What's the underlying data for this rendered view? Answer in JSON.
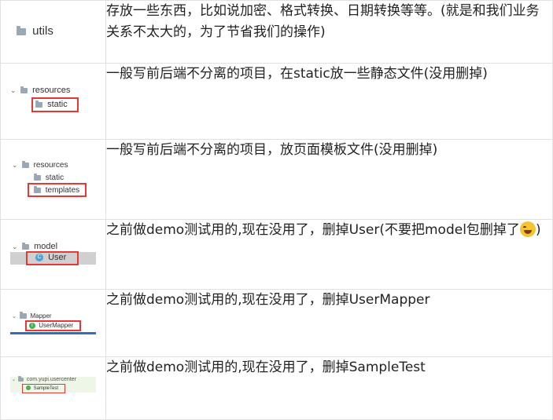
{
  "rows": [
    {
      "thumb": {
        "folder": "utils"
      },
      "text": "存放一些东西，比如说加密、格式转换、日期转换等等。(就是和我们业务关系不太大的，为了节省我们的操作)"
    },
    {
      "thumb": {
        "parent": "resources",
        "child": "static"
      },
      "text": "一般写前后端不分离的项目，在static放一些静态文件(没用删掉)"
    },
    {
      "thumb": {
        "parent": "resources",
        "sibling": "static",
        "child": "templates"
      },
      "text": "一般写前后端不分离的项目，放页面模板文件(没用删掉)"
    },
    {
      "thumb": {
        "parent": "model",
        "child": "User",
        "child_icon": "C"
      },
      "text_before": "之前做demo测试用的,现在没用了，删掉User(不要把model包删掉了",
      "text_after": ")",
      "emoji": "laughing-face-emoji"
    },
    {
      "thumb": {
        "parent": "Mapper",
        "child": "UserMapper",
        "child_icon": "I"
      },
      "text": "之前做demo测试用的,现在没用了，删掉UserMapper"
    },
    {
      "thumb": {
        "parent": "com.yupi.usercenter",
        "child": "SampleTest"
      },
      "text": "之前做demo测试用的,现在没用了，删掉SampleTest"
    }
  ],
  "colors": {
    "highlight_border": "#e53935",
    "selection_bg": "#d0d0d0",
    "mapper_bar": "#2f6fbf"
  }
}
